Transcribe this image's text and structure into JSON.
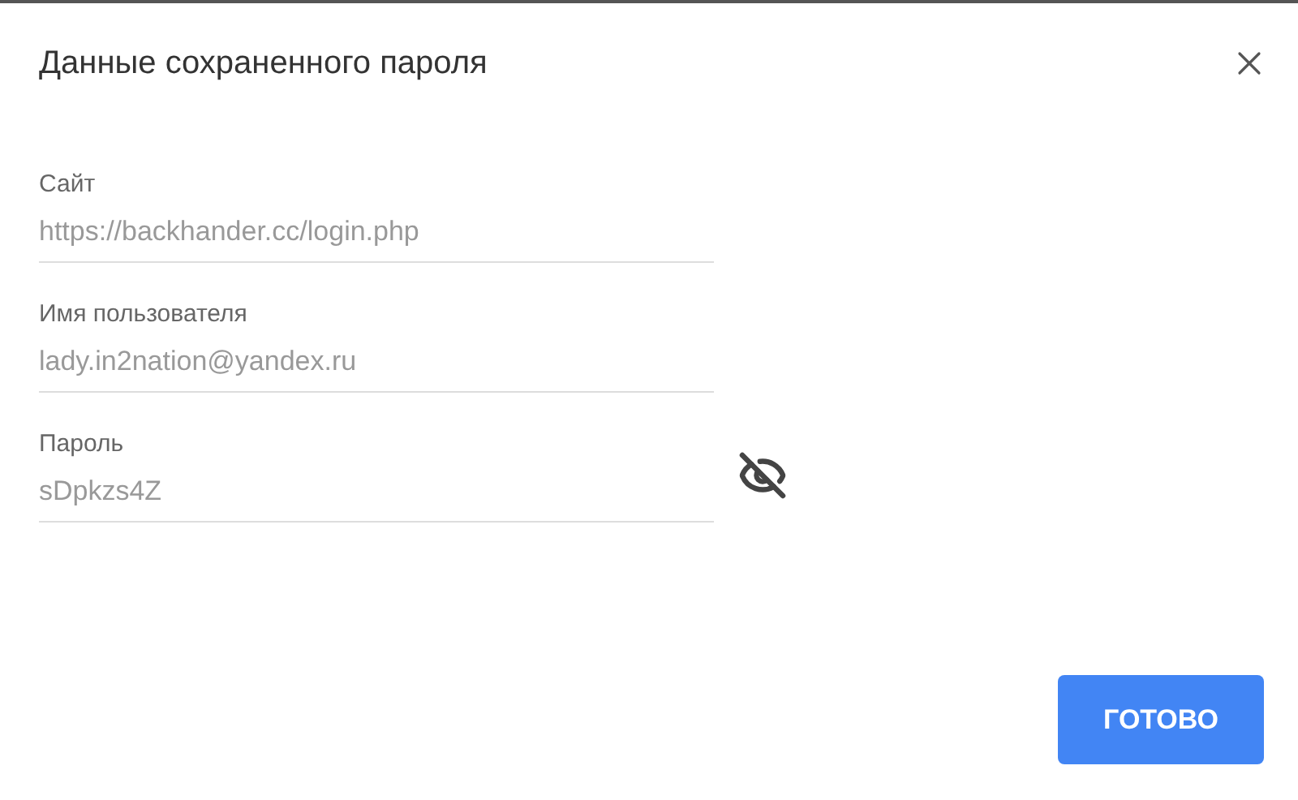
{
  "dialog": {
    "title": "Данные сохраненного пароля"
  },
  "fields": [
    {
      "kind": "text",
      "label": "Сайт",
      "value": "https://backhander.cc/login.php"
    },
    {
      "kind": "text",
      "label": "Имя пользователя",
      "value": "lady.in2nation@yandex.ru"
    },
    {
      "kind": "password",
      "label": "Пароль",
      "value": "sDpkzs4Z",
      "visible": true
    }
  ],
  "buttons": [
    "ГОТОВО"
  ]
}
